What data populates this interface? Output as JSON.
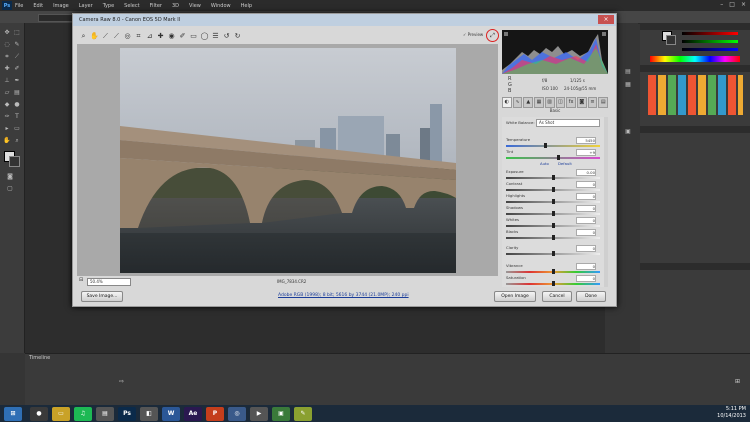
{
  "photoshop": {
    "logo": "Ps",
    "menu": [
      "File",
      "Edit",
      "Image",
      "Layer",
      "Type",
      "Select",
      "Filter",
      "3D",
      "View",
      "Window",
      "Help"
    ],
    "window_controls": [
      "–",
      "□",
      "×"
    ],
    "timeline_label": "Timeline"
  },
  "dialog": {
    "title": "Camera Raw 8.0 - Canon EOS 5D Mark II",
    "close": "×",
    "preview_label": "✓ Preview",
    "zoom_value": "50.4%",
    "filename": "IMG_7834.CR2",
    "workflow_link": "Adobe RGB (1998); 8 bit; 5616 by 3744 (21.0MP); 240 ppi",
    "buttons": {
      "save": "Save Image...",
      "open": "Open Image",
      "cancel": "Cancel",
      "done": "Done"
    },
    "readout": {
      "f": "f/8",
      "shutter": "1/125 s",
      "iso": "ISO 100",
      "lens": "24-105@55 mm"
    },
    "panel_title": "Basic",
    "white_balance": {
      "label": "White Balance:",
      "value": "As Shot"
    },
    "auto_default": {
      "auto": "Auto",
      "default": "Default"
    },
    "sliders": [
      {
        "label": "Temperature",
        "value": "5450",
        "pos": 0.42,
        "track": "temp"
      },
      {
        "label": "Tint",
        "value": "+9",
        "pos": 0.55,
        "track": "tint"
      },
      {
        "label": "Exposure",
        "value": "0.00",
        "pos": 0.5,
        "track": "gray"
      },
      {
        "label": "Contrast",
        "value": "0",
        "pos": 0.5,
        "track": "gray"
      },
      {
        "label": "Highlights",
        "value": "0",
        "pos": 0.5,
        "track": "gray"
      },
      {
        "label": "Shadows",
        "value": "0",
        "pos": 0.5,
        "track": "gray"
      },
      {
        "label": "Whites",
        "value": "0",
        "pos": 0.5,
        "track": "gray"
      },
      {
        "label": "Blacks",
        "value": "0",
        "pos": 0.5,
        "track": "gray"
      },
      {
        "label": "Clarity",
        "value": "0",
        "pos": 0.5,
        "track": "gray"
      },
      {
        "label": "Vibrance",
        "value": "0",
        "pos": 0.5,
        "track": "sat"
      },
      {
        "label": "Saturation",
        "value": "0",
        "pos": 0.5,
        "track": "sat"
      }
    ]
  },
  "taskbar": {
    "apps": [
      {
        "name": "start",
        "label": "⊞",
        "color": "#2f6fb5"
      },
      {
        "name": "chrome",
        "label": "●",
        "color": "#3a3a3a"
      },
      {
        "name": "folder",
        "label": "▭",
        "color": "#c9a227"
      },
      {
        "name": "spotify",
        "label": "♫",
        "color": "#1db954"
      },
      {
        "name": "app",
        "label": "▤",
        "color": "#555"
      },
      {
        "name": "photoshop",
        "label": "Ps",
        "color": "#0b2a4a"
      },
      {
        "name": "app2",
        "label": "◧",
        "color": "#555"
      },
      {
        "name": "word",
        "label": "W",
        "color": "#2b5797"
      },
      {
        "name": "aftereffects",
        "label": "Ae",
        "color": "#2a1850"
      },
      {
        "name": "powerpoint",
        "label": "P",
        "color": "#c43e1c"
      },
      {
        "name": "globe",
        "label": "◎",
        "color": "#3a5a8a"
      },
      {
        "name": "media",
        "label": "▶",
        "color": "#555"
      },
      {
        "name": "green",
        "label": "▣",
        "color": "#3a7a3a"
      },
      {
        "name": "notes",
        "label": "✎",
        "color": "#8aa030"
      }
    ],
    "time": "5:11 PM",
    "date": "10/14/2013"
  },
  "colors": {
    "accent": "#c75050",
    "link": "#1a3c99"
  }
}
